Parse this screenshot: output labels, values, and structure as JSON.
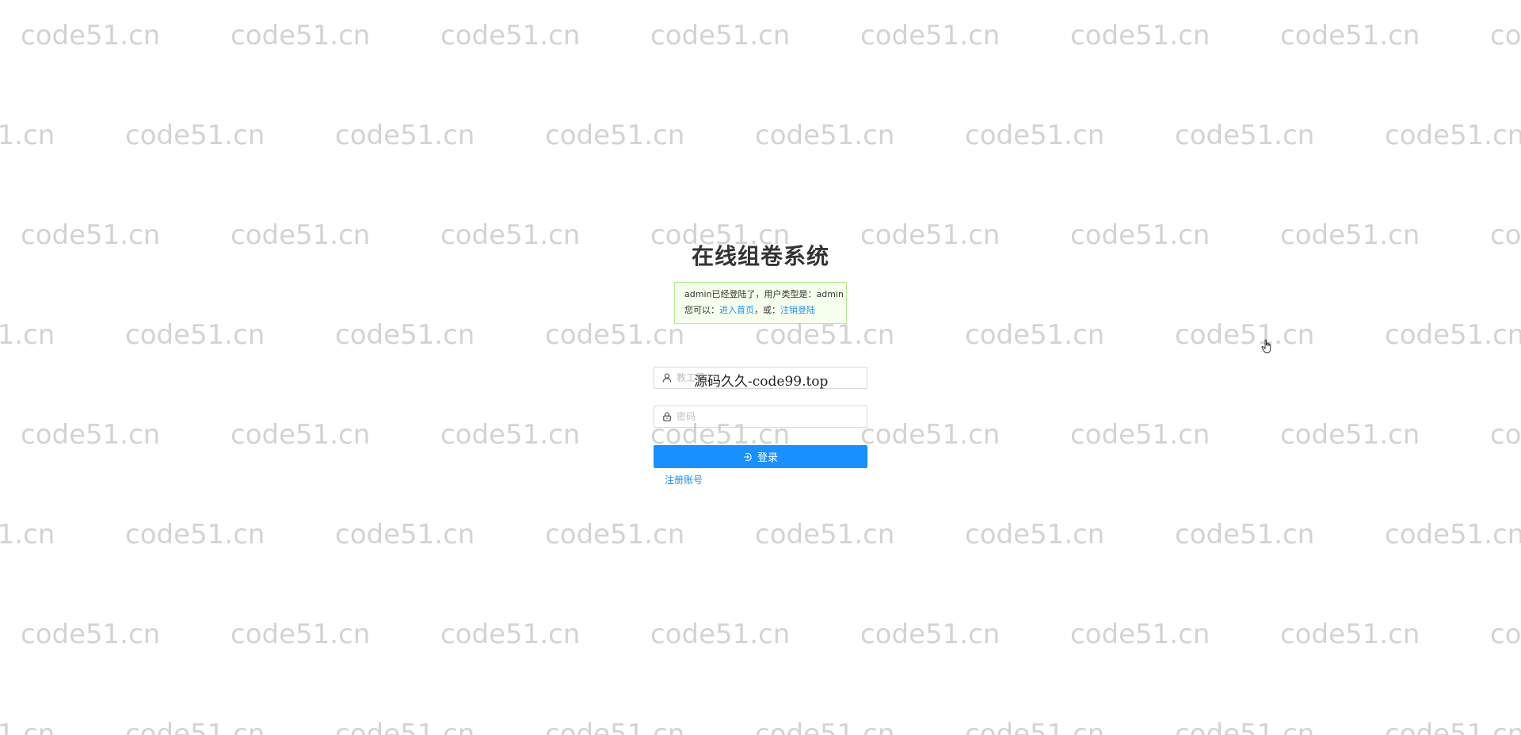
{
  "watermark_text": "code51.cn",
  "title": "在线组卷系统",
  "notice": {
    "line1": "admin已经登陆了，用户类型是：admin",
    "line2_prefix": "您可以：",
    "enter_home_link": "进入首页",
    "or_text": "，或：",
    "logout_link": "注销登陆"
  },
  "username": {
    "placeholder": "教工号",
    "icon": "user-icon"
  },
  "password": {
    "placeholder": "密码",
    "icon": "lock-icon"
  },
  "overlay_watermark": "源码久久-code99.top",
  "login_button": {
    "label": "登录",
    "icon": "login-icon"
  },
  "register_link": "注册账号",
  "colors": {
    "primary": "#1890ff",
    "notice_bg": "#f6ffed",
    "notice_border": "#b7eb8f"
  }
}
